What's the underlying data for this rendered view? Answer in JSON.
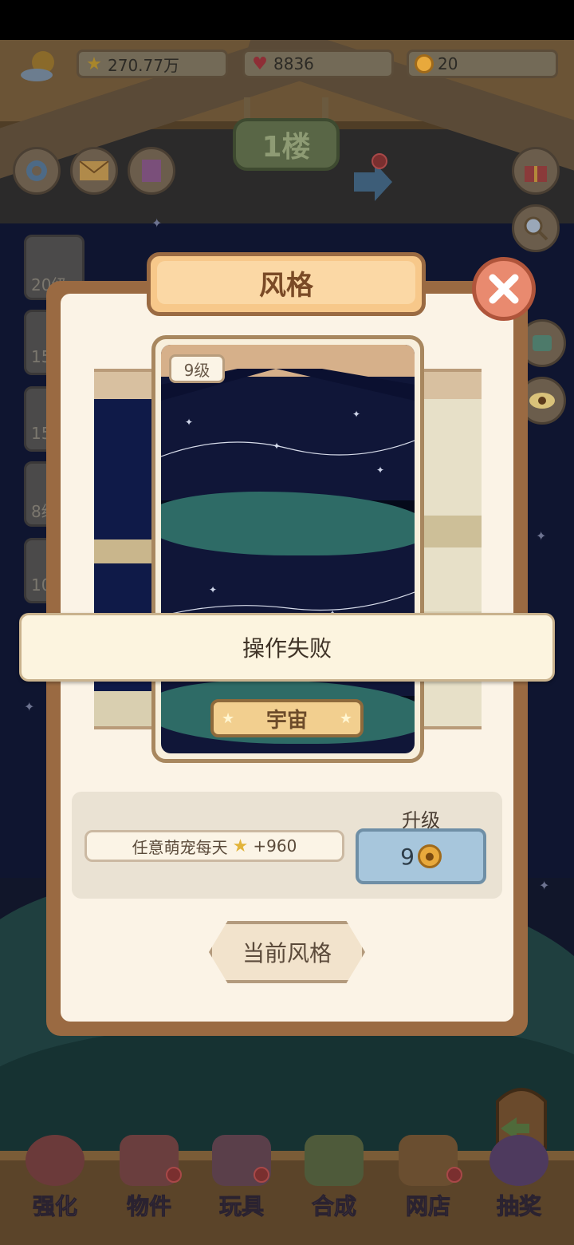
{
  "hud": {
    "stars": "270.77万",
    "hearts": "8836",
    "coins": "20"
  },
  "floor": {
    "label": "1楼"
  },
  "side_levels": [
    "20级",
    "15",
    "15",
    "8级",
    "10"
  ],
  "dialog": {
    "title": "风格",
    "level": "9级",
    "style_name": "宇宙",
    "reward_text": "任意萌宠每天",
    "reward_amount": "+960",
    "upgrade_label": "升级",
    "upgrade_cost": "9",
    "current_style_button": "当前风格"
  },
  "toast": {
    "message": "操作失败"
  },
  "bottom_tabs": [
    {
      "label": "强化"
    },
    {
      "label": "物件"
    },
    {
      "label": "玩具"
    },
    {
      "label": "合成"
    },
    {
      "label": "网店"
    },
    {
      "label": "抽奖"
    }
  ],
  "colors": {
    "accent_brown": "#9a6a42",
    "dialog_bg": "#fbf3e6",
    "upgrade_button": "#a7c6dc",
    "close_button": "#e98a6f"
  }
}
